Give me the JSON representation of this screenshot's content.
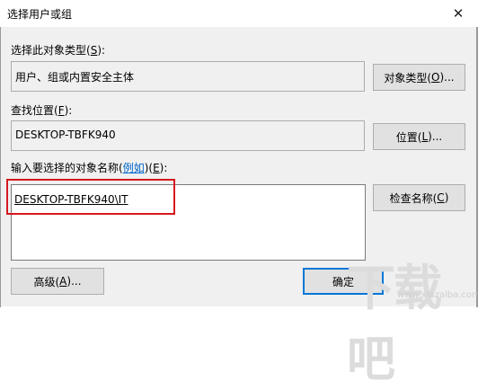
{
  "window": {
    "title": "选择用户或组"
  },
  "object_type": {
    "label_text": "选择此对象类型(",
    "label_key": "S",
    "label_end": "):",
    "value": "用户、组或内置安全主体",
    "button_text": "对象类型(",
    "button_key": "O",
    "button_end": ")..."
  },
  "location": {
    "label_text": "查找位置(",
    "label_key": "F",
    "label_end": "):",
    "value": "DESKTOP-TBFK940",
    "button_text": "位置(",
    "button_key": "L",
    "button_end": ")..."
  },
  "names": {
    "label_text": "输入要选择的对象名称(",
    "label_link": "例如",
    "label_mid": ")(",
    "label_key": "E",
    "label_end": "):",
    "value": "DESKTOP-TBFK940\\IT",
    "check_text": "检查名称(",
    "check_key": "C",
    "check_end": ")"
  },
  "footer": {
    "advanced_text": "高级(",
    "advanced_key": "A",
    "advanced_end": ")...",
    "ok_text": "确定"
  },
  "watermark": {
    "url": "www.xiazaiba.com"
  },
  "colors": {
    "highlight": "#d7181f",
    "accent": "#0078d7",
    "link": "#0066cc"
  }
}
